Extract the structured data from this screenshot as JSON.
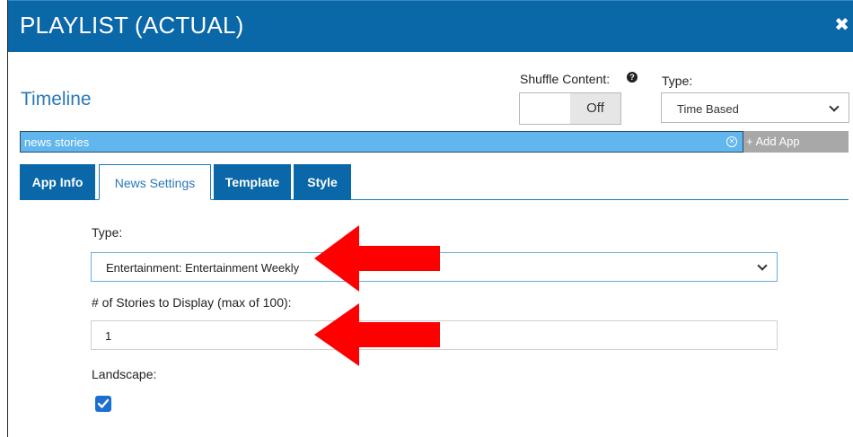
{
  "dialog": {
    "title": "PLAYLIST (ACTUAL)",
    "close_icon": "close-icon"
  },
  "header": {
    "section_title": "Timeline",
    "shuffle_label": "Shuffle Content:",
    "shuffle_help_icon": "question-circle-icon",
    "shuffle_state": "Off",
    "type_label": "Type:",
    "type_value": "Time Based"
  },
  "app_bar": {
    "app_name": "news stories",
    "clear_icon": "clear-circle-icon",
    "add_app_label": "+ Add App"
  },
  "tabs": [
    {
      "label": "App Info",
      "active": false
    },
    {
      "label": "News Settings",
      "active": true
    },
    {
      "label": "Template",
      "active": false
    },
    {
      "label": "Style",
      "active": false
    }
  ],
  "news_settings": {
    "type_label": "Type:",
    "type_value": "Entertainment: Entertainment Weekly",
    "count_label": "# of Stories to Display (max of 100):",
    "count_value": "1",
    "landscape_label": "Landscape:",
    "landscape_checked": true
  },
  "annotations": {
    "arrow_color": "#ff0000",
    "arrow_icon": "red-arrow-icon"
  },
  "colors": {
    "titlebar": "#0a67a8",
    "accent": "#2a78b8",
    "app_bar": "#62b6ee",
    "add_app": "#a8a8a8"
  }
}
